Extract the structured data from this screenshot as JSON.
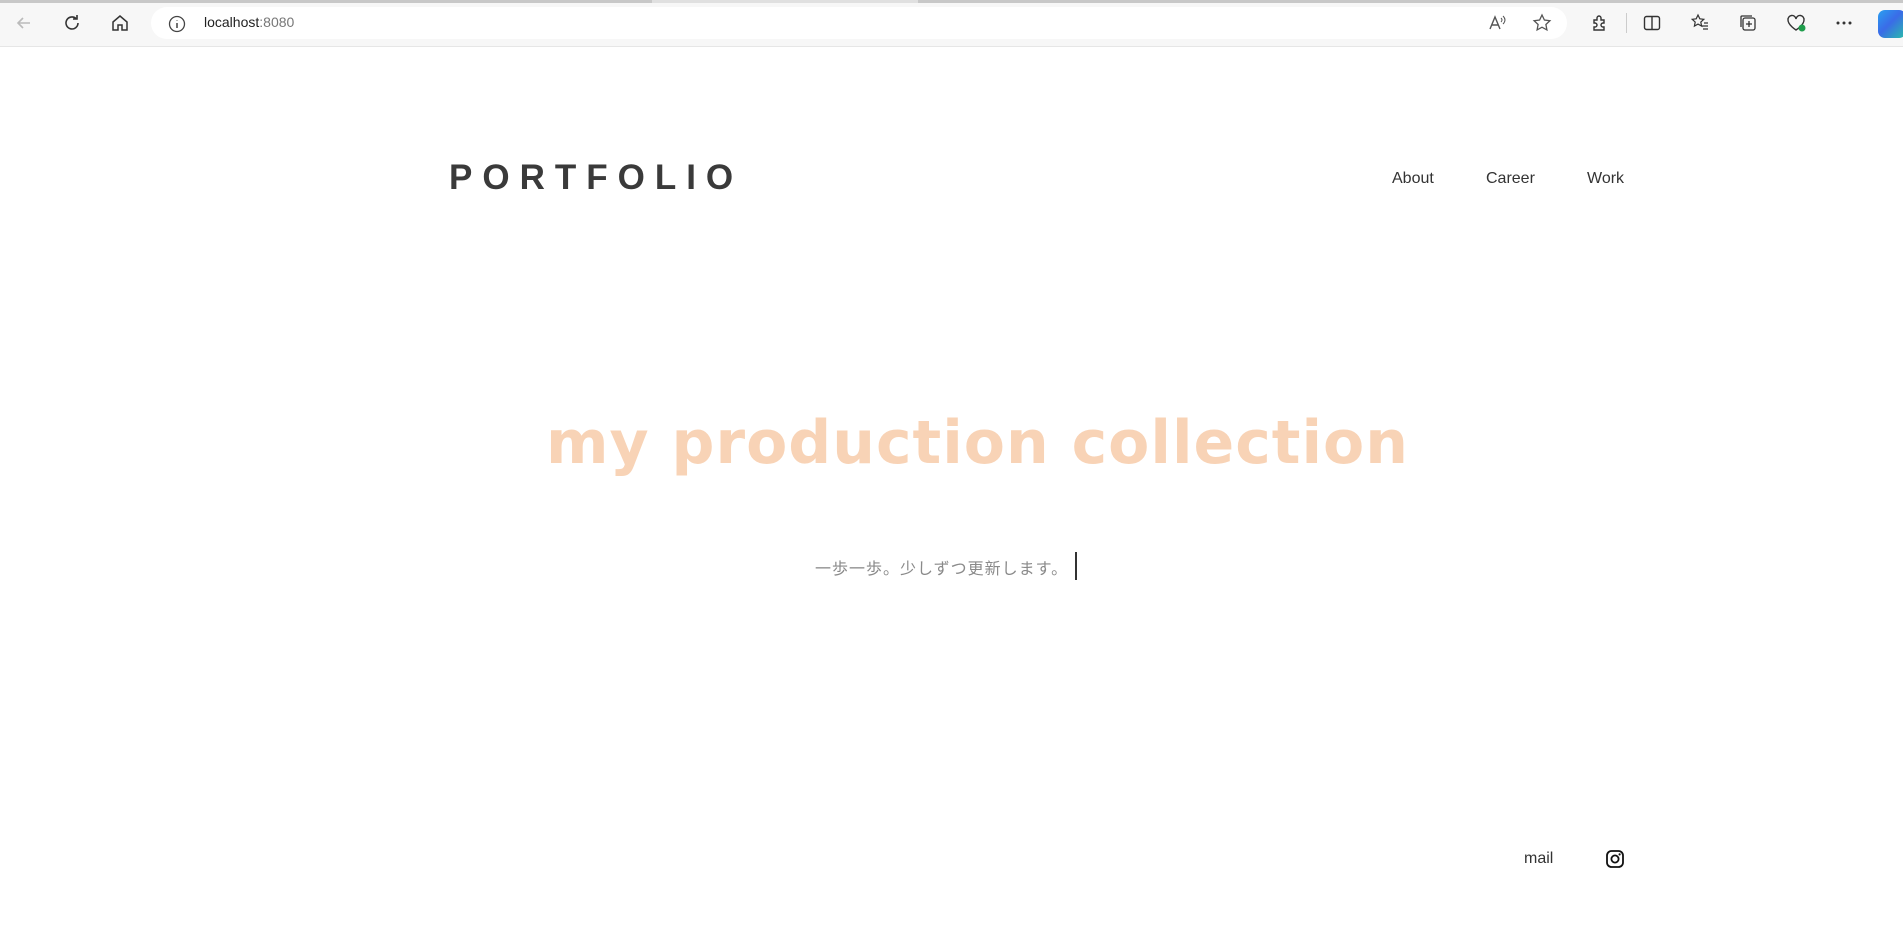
{
  "browser": {
    "url_host": "localhost",
    "url_port": ":8080"
  },
  "header": {
    "logo": "PORTFOLIO",
    "nav": [
      "About",
      "Career",
      "Work"
    ]
  },
  "hero": {
    "title": "my production collection",
    "subtitle": "一歩一歩。少しずつ更新します。"
  },
  "footer": {
    "mail": "mail",
    "instagram_icon": "instagram-icon"
  },
  "colors": {
    "hero_title": "#f8d3b6",
    "logo": "#3a3a3a",
    "subtitle": "#8a8a8a"
  }
}
